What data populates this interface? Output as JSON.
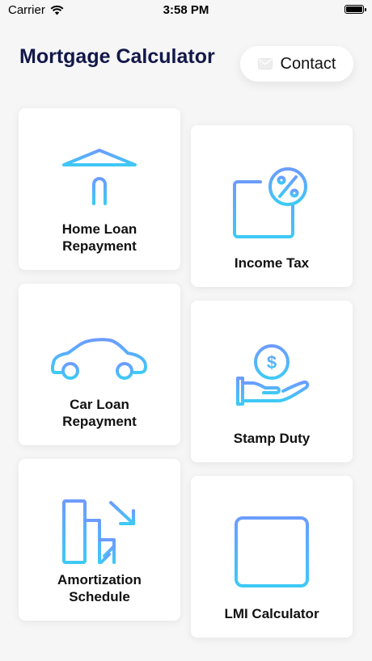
{
  "status_bar": {
    "carrier": "Carrier",
    "time": "3:58 PM"
  },
  "header": {
    "title": "Mortgage Calculator",
    "contact_label": "Contact"
  },
  "colors": {
    "title": "#13184a",
    "icon_gradient_start": "#6c9cff",
    "icon_gradient_end": "#3ec9f5"
  },
  "cards": [
    {
      "label": "Home Loan\nRepayment",
      "icon": "bank-icon"
    },
    {
      "label": "Income Tax",
      "icon": "income-tax-icon"
    },
    {
      "label": "Car Loan\nRepayment",
      "icon": "car-icon"
    },
    {
      "label": "Stamp Duty",
      "icon": "stamp-duty-icon"
    },
    {
      "label": "Amortization\nSchedule",
      "icon": "amortization-icon"
    },
    {
      "label": "LMI Calculator",
      "icon": "calculator-icon"
    }
  ]
}
